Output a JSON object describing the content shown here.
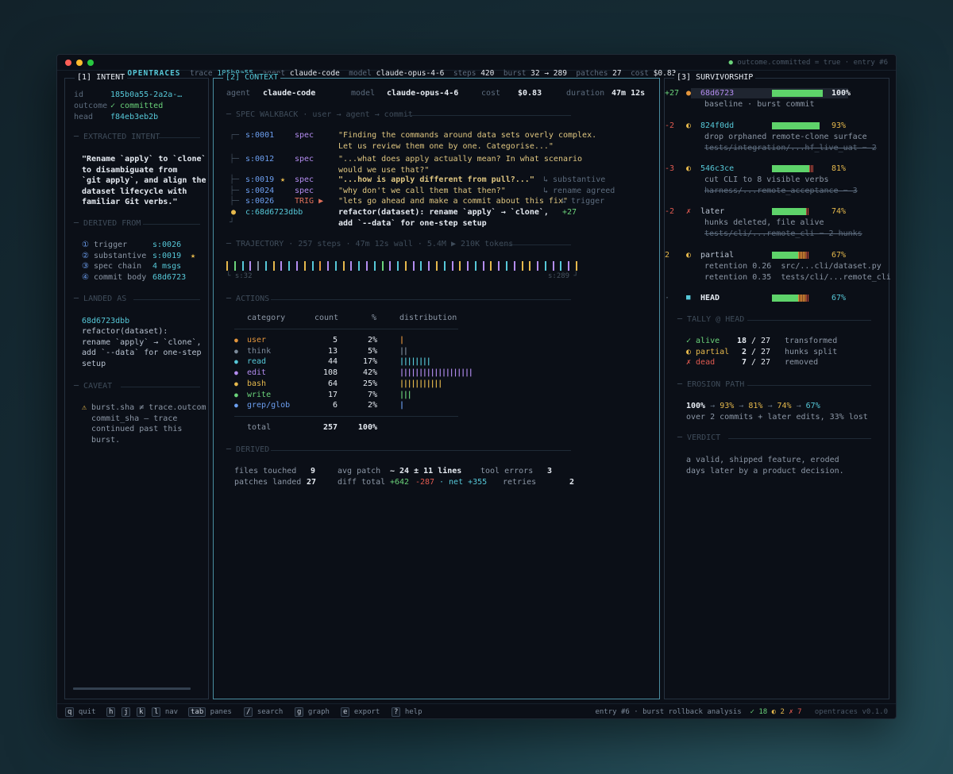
{
  "titlebar": {
    "app": "OPENTRACES",
    "trace_label": "trace",
    "trace": "185b0a55",
    "agent_label": "agent",
    "agent": "claude-code",
    "model_label": "model",
    "model": "claude-opus-4-6",
    "steps_label": "steps",
    "steps": "420",
    "burst_label": "burst",
    "burst": "32 → 289",
    "patches_label": "patches",
    "patches": "27",
    "cost_label": "cost",
    "cost": "$0.83",
    "status": "● outcome.committed = true · entry #6"
  },
  "intent": {
    "title": "[1] INTENT",
    "id_label": "id",
    "id": "185b0a55-2a2a-…",
    "outcome_label": "outcome",
    "outcome": "✓ committed",
    "head_label": "head",
    "head": "f84eb3eb2b",
    "extracted_title": "EXTRACTED INTENT",
    "extracted_lines": [
      "\"Rename `apply` to `clone`",
      "to disambiguate from",
      "`git apply`, and align the",
      "dataset lifecycle with",
      "familiar Git verbs.\""
    ],
    "derived_title": "DERIVED FROM",
    "derived": [
      {
        "num": "①",
        "label": "trigger",
        "value": "s:0026",
        "star": ""
      },
      {
        "num": "②",
        "label": "substantive",
        "value": "s:0019",
        "star": "★"
      },
      {
        "num": "③",
        "label": "spec chain",
        "value": "4 msgs",
        "star": ""
      },
      {
        "num": "④",
        "label": "commit body",
        "value": "68d6723",
        "star": ""
      }
    ],
    "landed_title": "LANDED AS",
    "landed_sha": "68d6723dbb",
    "landed_lines": [
      "refactor(dataset):",
      "rename `apply` → `clone`,",
      "add `--data` for one-step",
      "setup"
    ],
    "caveat_title": "CAVEAT",
    "caveat_icon": "⚠",
    "caveat_lines": [
      "burst.sha ≠ trace.outcom",
      "commit_sha — trace",
      "continued past this",
      "burst."
    ]
  },
  "context": {
    "title": "[2] CONTEXT",
    "agent_label": "agent",
    "agent": "claude-code",
    "model_label": "model",
    "model": "claude-opus-4-6",
    "cost_label": "cost",
    "cost": "$0.83",
    "duration_label": "duration",
    "duration": "47m 12s",
    "walkback_title": "SPEC WALKBACK · user → agent → commit",
    "walkback": [
      {
        "tree": "┌─",
        "step": "s:0001",
        "star": "",
        "role": "spec",
        "lines": [
          "\"Finding the commands around data sets overly complex.",
          "Let us review them one by one. Categorise...\""
        ],
        "note": "",
        "bold": false
      },
      {
        "tree": "├─",
        "step": "s:0012",
        "star": "",
        "role": "spec",
        "lines": [
          "\"...what does apply actually mean? In what scenario",
          "would we use that?\""
        ],
        "note": "",
        "bold": false
      },
      {
        "tree": "├─",
        "step": "s:0019",
        "star": "★",
        "role": "spec",
        "lines": [
          "\"...how is apply different from pull?...\""
        ],
        "note": "↳ substantive",
        "bold": true
      },
      {
        "tree": "├─",
        "step": "s:0024",
        "star": "",
        "role": "spec",
        "lines": [
          "\"why don't we call them that then?\""
        ],
        "note": "↳ rename agreed",
        "bold": false
      },
      {
        "tree": "├─",
        "step": "s:0026",
        "star": "",
        "role": "TRIG ▶",
        "lines": [
          "\"lets go ahead and make a commit about this fix\""
        ],
        "note": "↳ trigger",
        "bold": false
      },
      {
        "tree": "●",
        "step": "c:68d6723dbb",
        "star": "",
        "role": "",
        "lines": [
          "refactor(dataset): rename `apply` → `clone`,",
          "add `--data` for one-step setup"
        ],
        "note": "+27",
        "bold": true
      }
    ],
    "walkback_end": "┘",
    "trajectory_title": "TRAJECTORY · 257 steps · 47m 12s wall · 5.4M ▶ 210K tokens",
    "traj_start": "└ s:32",
    "traj_end": "s:289 ┘",
    "trajectory_ticks": [
      "bash",
      "write",
      "read",
      "edit",
      "think",
      "read",
      "bash",
      "edit",
      "read",
      "edit",
      "bash",
      "read",
      "user",
      "edit",
      "read",
      "bash",
      "edit",
      "read",
      "edit",
      "read",
      "write",
      "edit",
      "read",
      "bash",
      "edit",
      "read",
      "edit",
      "bash",
      "read",
      "edit",
      "bash",
      "edit",
      "read",
      "edit",
      "bash",
      "edit",
      "read",
      "edit",
      "bash",
      "bash",
      "edit",
      "read",
      "edit",
      "read",
      "edit",
      "bash"
    ],
    "actions_title": "ACTIONS",
    "actions_headers": {
      "category": "category",
      "count": "count",
      "pct": "%",
      "dist": "distribution"
    },
    "actions": [
      {
        "cat": "user",
        "color": "#e3953c",
        "count": "5",
        "pct": "2%",
        "dist": "|"
      },
      {
        "cat": "think",
        "color": "#7c8a9a",
        "count": "13",
        "pct": "5%",
        "dist": "||"
      },
      {
        "cat": "read",
        "color": "#56c8d8",
        "count": "44",
        "pct": "17%",
        "dist": "||||||||"
      },
      {
        "cat": "edit",
        "color": "#b38cf0",
        "count": "108",
        "pct": "42%",
        "dist": "|||||||||||||||||||"
      },
      {
        "cat": "bash",
        "color": "#e5b84c",
        "count": "64",
        "pct": "25%",
        "dist": "|||||||||||"
      },
      {
        "cat": "write",
        "color": "#6bd37a",
        "count": "17",
        "pct": "7%",
        "dist": "|||"
      },
      {
        "cat": "grep/glob",
        "color": "#6c9ff0",
        "count": "6",
        "pct": "2%",
        "dist": "|"
      }
    ],
    "actions_total": {
      "label": "total",
      "count": "257",
      "pct": "100%"
    },
    "derived_title": "DERIVED",
    "files_touched_label": "files touched",
    "files_touched": "9",
    "avg_patch_label": "avg patch",
    "avg_patch": "~ 24 ± 11 lines",
    "tool_errors_label": "tool errors",
    "tool_errors": "3",
    "patches_landed_label": "patches landed",
    "patches_landed": "27",
    "diff_total_label": "diff total",
    "diff_add": "+642",
    "diff_del": "-287",
    "diff_net": "· net +355",
    "retries_label": "retries",
    "retries": "2"
  },
  "survivorship": {
    "title": "[3] SURVIVORSHIP",
    "entries": [
      {
        "icon": "●",
        "icon_color": "#e3953c",
        "name": "68d6723",
        "delta": "+27",
        "green": 1.0,
        "orange": 0,
        "red": 0,
        "pct": "100%",
        "sub1": "baseline · burst commit",
        "sub1_strike": false,
        "sub2": "",
        "sub2_strike": false,
        "highlight": true
      },
      {
        "icon": "◐",
        "icon_color": "#e5b84c",
        "name": "824f0dd",
        "delta": "-2",
        "green": 0.93,
        "orange": 0,
        "red": 0,
        "pct": "93%",
        "sub1": "drop orphaned remote-clone surface",
        "sub1_strike": false,
        "sub2": "tests/integration/...hf_live_uat − 2",
        "sub2_strike": true,
        "highlight": false
      },
      {
        "icon": "◐",
        "icon_color": "#e5b84c",
        "name": "546c3ce",
        "delta": "-3",
        "green": 0.74,
        "orange": 0,
        "red": 0.07,
        "pct": "81%",
        "sub1": "cut CLI to 8 visible verbs",
        "sub1_strike": false,
        "sub2": "harness/...remote_acceptance − 3",
        "sub2_strike": true,
        "highlight": false
      },
      {
        "icon": "✗",
        "icon_color": "#e05a50",
        "name": "later",
        "delta": "-2",
        "green": 0.67,
        "orange": 0,
        "red": 0.07,
        "pct": "74%",
        "sub1": "hunks deleted, file alive",
        "sub1_strike": false,
        "sub2": "tests/cli/...remote_cli − 2 hunks",
        "sub2_strike": true,
        "highlight": false
      },
      {
        "icon": "◐",
        "icon_color": "#e5b84c",
        "name": "partial",
        "delta": "2",
        "green": 0.52,
        "orange": 0.15,
        "red": 0.07,
        "pct": "67%",
        "sub1": "retention 0.26  src/...cli/dataset.py",
        "sub1_strike": false,
        "sub2": "retention 0.35  tests/cli/...remote_cli",
        "sub2_strike": false,
        "highlight": false
      },
      {
        "icon": "■",
        "icon_color": "#56c8d8",
        "name": "HEAD",
        "delta": "·",
        "green": 0.52,
        "orange": 0.15,
        "red": 0.07,
        "pct": "67%",
        "sub1": "",
        "sub1_strike": false,
        "sub2": "",
        "sub2_strike": false,
        "highlight": false
      }
    ],
    "tally_title": "TALLY @ HEAD",
    "tally": [
      {
        "icon": "✓",
        "label": "alive",
        "color": "#6bd37a",
        "count": "18",
        "total": "/ 27",
        "desc": "transformed"
      },
      {
        "icon": "◐",
        "label": "partial",
        "color": "#e5b84c",
        "count": "2",
        "total": "/ 27",
        "desc": "hunks split"
      },
      {
        "icon": "✗",
        "label": "dead",
        "color": "#e05a50",
        "count": "7",
        "total": "/ 27",
        "desc": "removed"
      }
    ],
    "erosion_title": "EROSION PATH",
    "erosion": {
      "p1": "100%",
      "p2": "93%",
      "p3": "81%",
      "p4": "74%",
      "p5": "67%",
      "arrow": "→"
    },
    "erosion_note": "over 2 commits + later edits, 33% lost",
    "verdict_title": "VERDICT",
    "verdict_lines": [
      "a valid, shipped feature, eroded",
      "days later by a product decision."
    ]
  },
  "statusbar": {
    "keys": [
      {
        "key": "q",
        "label": "quit"
      },
      {
        "key": "h",
        "label": ""
      },
      {
        "key": "j",
        "label": ""
      },
      {
        "key": "k",
        "label": ""
      },
      {
        "key": "l",
        "label": "nav"
      },
      {
        "key": "tab",
        "label": "panes"
      },
      {
        "key": "/",
        "label": "search"
      },
      {
        "key": "g",
        "label": "graph"
      },
      {
        "key": "e",
        "label": "export"
      },
      {
        "key": "?",
        "label": "help"
      }
    ],
    "right_text": "entry #6 · burst rollback analysis",
    "alive": "✓ 18",
    "partial": "◐ 2",
    "dead": "✗ 7",
    "version": "opentraces v0.1.0"
  }
}
